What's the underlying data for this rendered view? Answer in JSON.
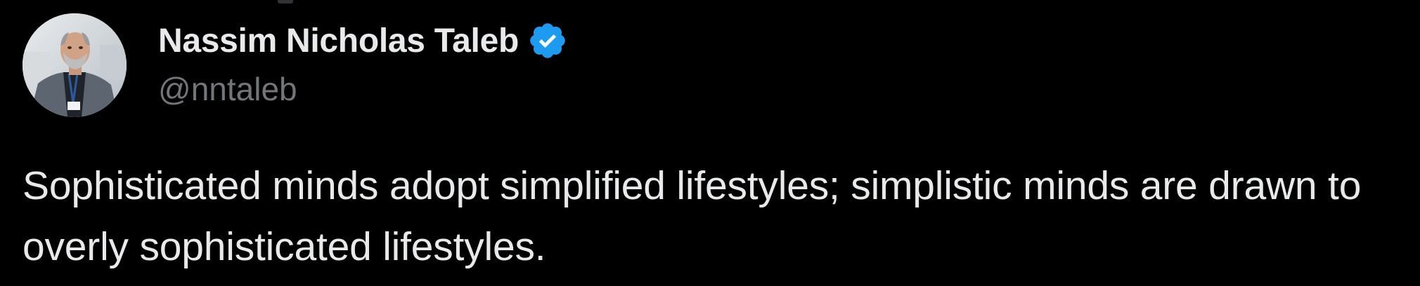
{
  "author": {
    "display_name": "Nassim Nicholas Taleb",
    "handle": "@nntaleb",
    "verified": true,
    "verified_color": "#1d9bf0"
  },
  "tweet": {
    "text": "Sophisticated minds adopt simplified lifestyles; simplistic minds are drawn to overly sophisticated lifestyles."
  },
  "colors": {
    "background": "#000000",
    "primary_text": "#e7e9ea",
    "secondary_text": "#71767b"
  }
}
